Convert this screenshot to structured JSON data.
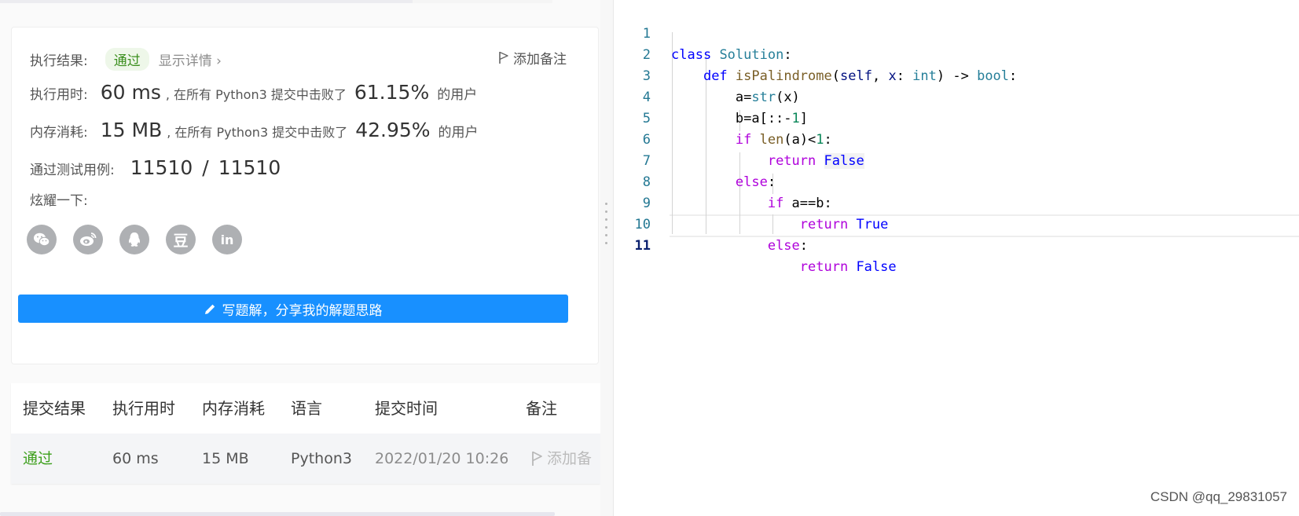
{
  "result": {
    "label": "执行结果:",
    "status": "通过",
    "details_link": "显示详情 ›",
    "add_note": "添加备注"
  },
  "runtime": {
    "label": "执行用时:",
    "value": "60 ms",
    "text": ", 在所有 Python3 提交中击败了",
    "percent": "61.15%",
    "suffix": "的用户"
  },
  "memory": {
    "label": "内存消耗:",
    "value": "15 MB",
    "text": ", 在所有 Python3 提交中击败了",
    "percent": "42.95%",
    "suffix": "的用户"
  },
  "tests": {
    "label": "通过测试用例:",
    "passed": "11510",
    "separator": "/",
    "total": "11510"
  },
  "share": {
    "label": "炫耀一下:",
    "icons": [
      "wechat-icon",
      "weibo-icon",
      "qq-icon",
      "douban-icon",
      "linkedin-icon"
    ],
    "douban_glyph": "豆",
    "linkedin_glyph": "in"
  },
  "write_button": "写题解，分享我的解题思路",
  "submissions": {
    "headers": [
      "提交结果",
      "执行用时",
      "内存消耗",
      "语言",
      "提交时间",
      "备注"
    ],
    "rows": [
      {
        "status": "通过",
        "runtime": "60 ms",
        "memory": "15 MB",
        "language": "Python3",
        "time": "2022/01/20 10:26",
        "note": "添加备"
      }
    ]
  },
  "editor": {
    "line_numbers": [
      "1",
      "2",
      "3",
      "4",
      "5",
      "6",
      "7",
      "8",
      "9",
      "10",
      "11"
    ],
    "lines": [
      "class Solution:",
      "    def isPalindrome(self, x: int) -> bool:",
      "        a=str(x)",
      "        b=a[::-1]",
      "        if len(a)<1:",
      "            return False",
      "        else:",
      "            if a==b:",
      "                return True",
      "            else:",
      "                return False"
    ],
    "current_line": "11"
  },
  "watermark": "CSDN @qq_29831057",
  "colors": {
    "accent": "#1890ff",
    "pass_green": "#3b9e1a",
    "line_number": "#237893",
    "keyword": "#0000ff",
    "keyword_control": "#af00db",
    "type": "#267f99",
    "function": "#795e26"
  }
}
